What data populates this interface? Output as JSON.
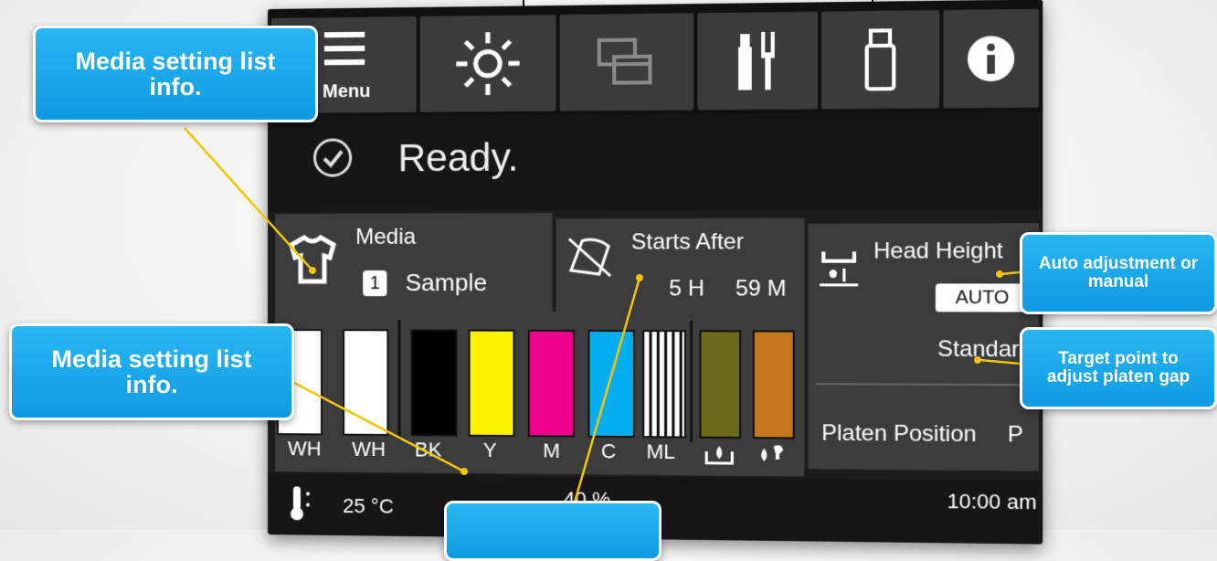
{
  "menu": {
    "label": "Menu"
  },
  "status": {
    "text": "Ready."
  },
  "media": {
    "label": "Media",
    "number": "1",
    "name": "Sample"
  },
  "starts_after": {
    "label": "Starts After",
    "hours": "5 H",
    "minutes": "59 M"
  },
  "head": {
    "label": "Head Height",
    "mode": "AUTO",
    "gap": "Standard",
    "platen_label": "Platen Position",
    "platen_value": "P"
  },
  "inks": [
    {
      "label": "WH",
      "color": "#ffffff"
    },
    {
      "label": "WH",
      "color": "#ffffff"
    },
    {
      "label": "BK",
      "color": "#000000"
    },
    {
      "label": "Y",
      "color": "#fff200"
    },
    {
      "label": "M",
      "color": "#ec008c"
    },
    {
      "label": "C",
      "color": "#00aeef"
    },
    {
      "label": "ML",
      "color": "#ffffff"
    },
    {
      "label": "",
      "color": "#6b6b1a"
    },
    {
      "label": "",
      "color": "#c6771b"
    }
  ],
  "bottom": {
    "temperature": "25 °C",
    "humidity": "40 %",
    "time": "10:00 am"
  },
  "callouts": {
    "media_top": "Media setting list info.",
    "media_left": "Media setting list info.",
    "auto": "Auto adjustment or manual",
    "target": "Target point to adjust platen gap"
  },
  "accent_color": "#1ea7ec"
}
